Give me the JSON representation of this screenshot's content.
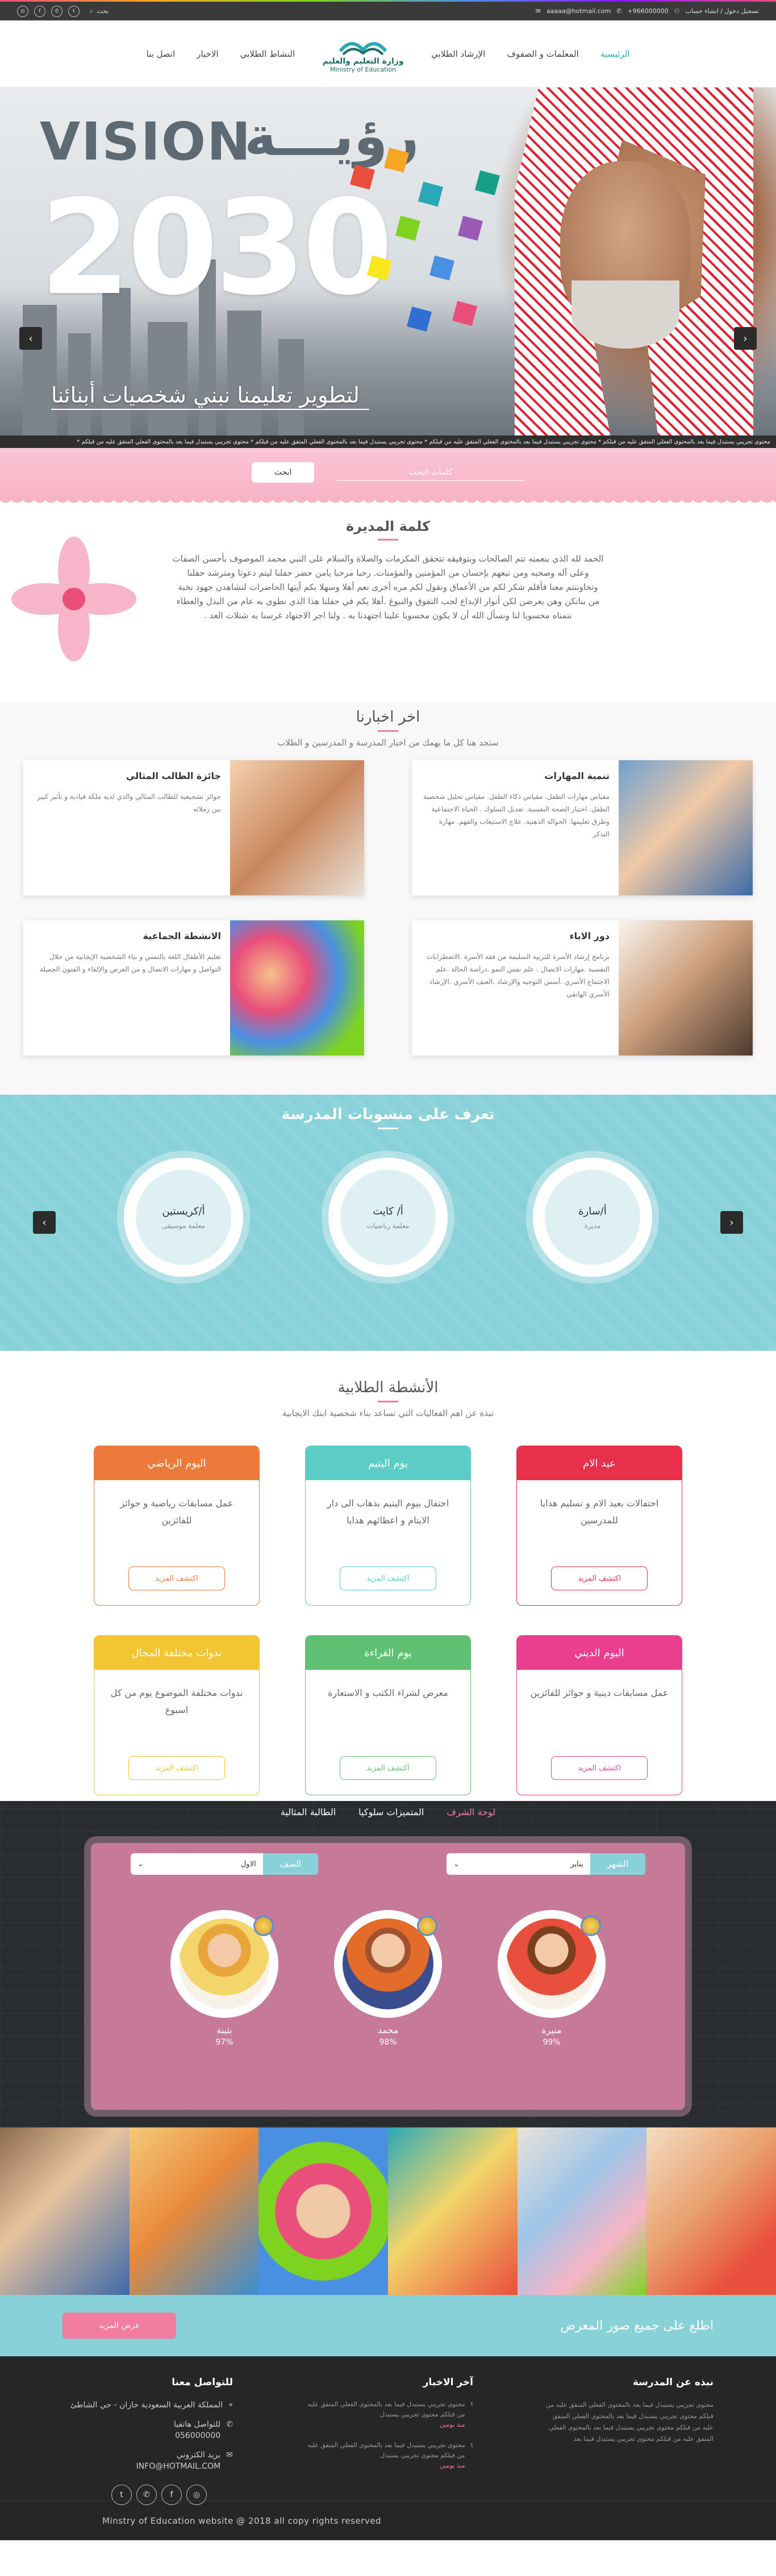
{
  "topbar": {
    "search_label": "بحث",
    "phone": "+966000000",
    "email": "aaaaa@hotmail.com",
    "login": "تسجيل دخول / انشاء حساب",
    "socials": [
      "instagram-icon",
      "facebook-icon",
      "whatsapp-icon",
      "twitter-icon"
    ]
  },
  "nav": {
    "items": [
      "الرئيسية",
      "المعلمات و الصفوف",
      "الإرشاد الطلابي",
      "النشاط الطلابي",
      "الاخبار",
      "اتصل بنا"
    ],
    "active": 0
  },
  "logo": {
    "ar": "وزارة التعليم والعليم",
    "en": "Ministry of Education"
  },
  "hero": {
    "vision": "VISION",
    "ru": "رؤيـــة",
    "year": "2030",
    "tagline": "لتطوير تعليمنا نبني شخصيات أبنائنا"
  },
  "ticker": "محتوى تجريبي يستبدل فيما بعد بالمحتوى الفعلي المتفق عليه من قبلكم * محتوى تجريبي يستبدل فيما بعد بالمحتوى الفعلي المتفق عليه من قبلكم * محتوى تجريبي يستبدل فيما بعد بالمحتوى الفعلي المتفق عليه من قبلكم * محتوى تجريبي يستبدل فيما بعد بالمحتوى الفعلي المتفق عليه من قبلكم *",
  "search": {
    "placeholder": "كلمات البحث",
    "button": "ابحث"
  },
  "principal": {
    "title": "كلمة المديرة",
    "text": "الحمد لله الذي بنعمته تتم الصالحات وبتوفيقه تتحقق المكرمات والصلاة والسلام على النبي محمد الموصوف بأحسن الصفات وعلى آله وصحبه ومن تبعهم بإحسان من المؤمنين والمؤمنات. رحبا مرحبا يامن حضر حفلنا ليتم دعوتا ومترشد حفلنا وتحاوننتم معنا فأقلم شكر لكم من الأعماق ونقول لكم مره أخرى نعم أهلا وسهلا بكم أيتها الحاضرات لتشاهدن جهود نخبة من بناتكن وهن يعرضن لكن أنوار الإبداع لحب التفوق والنبوغ .أهلا بكم في حفلنا هذا الذي نطوي به عام من البذل والعطاء نتمناه محسوبا لنا ونسأل الله أن لا يكون محسوبا علينا اجتهدنا به . ولنا اجر الاجتهاد غرسنا به شتلات العد ."
  },
  "news": {
    "title": "اخر اخبارنا",
    "subtitle": "ستجد هنا كل ما يهمك من اخبار المدرسة و المدرسين و الطلاب",
    "items": [
      {
        "title": "تنمية المهارات",
        "text": "مقياس مهارات الطفل. مقياس ذكاء الطفل. مقياس تحليل شخصية الطفل. اختبار الصحة النفسية. تعديل السلوك . الحياة الاجتماعية وطرق تعليمها. الخوالة الذهنية. علاج الاستيعاب والفهم. مهارة التذكر"
      },
      {
        "title": "جائزة الطالب المثالي",
        "text": "جوائز تشجيعية للطالب المثالي والذي لديه ملكة قيادية و تأثير كبير بين زملائه"
      },
      {
        "title": "دور الاباء",
        "text": "برنامج إرشاد الأسرة للتربية السليمة من فقه الأسرة .الاضطرابات النفسية .مهارات الاتصال . علم نفس النمو .دراسة الحالة .علم الاجتماع الأسري .أسس التوجيه والإرشاد .العنف الأسري .الإرشاد الأسري الهاتفي"
      },
      {
        "title": "الانشطة الجماعية",
        "text": "تعليم الأطفال اللغة بالتمس و بناء الشخصية الإيجابية من خلال التواصل و مهارات الاتصال و من العرض والإلقاء و الفنون الجميلة"
      }
    ]
  },
  "staff": {
    "title": "تعرف على منسوبات المدرسة",
    "members": [
      {
        "name": "أ/سارة",
        "role": "مديرة"
      },
      {
        "name": "أ/ كايت",
        "role": "معلمة رياضيات"
      },
      {
        "name": "أ/كريستين",
        "role": "معلمة موسيقى"
      }
    ]
  },
  "activities": {
    "title": "الأنشطة الطلابية",
    "subtitle": "نبذة عن اهم الفعاليات التي تساعد بناء شخصية ابنك الايجابية",
    "more": "اكتشف المزيد",
    "items": [
      {
        "title": "عيد الام",
        "text": "احتفالات بعيد الام و تسليم هدايا للمدرسين",
        "color": "#e8304b"
      },
      {
        "title": "يوم اليتيم",
        "text": "احتفال بيوم اليتيم بذهاب الى دار الايتام و اعطائهم هدايا",
        "color": "#5ccdc6"
      },
      {
        "title": "اليوم الرياضي",
        "text": "عمل مسابقات رياضية و جوائز للفائزين",
        "color": "#ec7a3a"
      },
      {
        "title": "اليوم الديني",
        "text": "عمل مسابقات دينية و جوائز للفائزين",
        "color": "#ea3f8f"
      },
      {
        "title": "يوم القراءة",
        "text": "معرض لشراء الكتب و الاستعارة",
        "color": "#5fbf72"
      },
      {
        "title": "ندوات مختلفة المجال",
        "text": "ندوات مختلفة الموضوع يوم من كل اسبوع",
        "color": "#f3c532"
      }
    ]
  },
  "honor": {
    "tabs": [
      "لوحة الشرف",
      "المتميزات سلوكيا",
      "الطالبة المثالية"
    ],
    "month_label": "الشهر",
    "month_value": "يناير",
    "class_label": "الصف",
    "class_value": "الاول",
    "students": [
      {
        "name": "منيرة",
        "score": "99%"
      },
      {
        "name": "محمد",
        "score": "98%"
      },
      {
        "name": "بثينة",
        "score": "97%"
      }
    ]
  },
  "gallery": {
    "title": "اطلع على جميع صور المعرض",
    "button": "عرض المزيد"
  },
  "footer": {
    "about_title": "نبذه عن المدرسة",
    "about_text": "محتوى تجريبي يستبدل فيما بعد بالمحتوى الفعلي المتفق عليه من قبلكم محتوى تجريبي يستبدل فيما بعد بالمحتوى الفعلي المتفق عليه من قبلكم محتوى تجريبي يستبدل فيما بعد بالمحتوى الفعلي المتفق عليه من قبلكم محتوى تجريبي يستبدل فيما بعد",
    "news_title": "آخر الاخبار",
    "news_items": [
      {
        "text": "محتوى تجريبي يستبدل فيما بعد بالمحتوى الفعلي المتفق عليه من قبلكم محتوى تجريبي يستبدل",
        "date": "منذ يومين"
      },
      {
        "text": "محتوى تجريبي يستبدل فيما بعد بالمحتوى الفعلي المتفق عليه من قبلكم محتوى تجريبي يستبدل",
        "date": "منذ يومين"
      }
    ],
    "contact_title": "للتواصل معنا",
    "address": "المملكة العربية السعودية جازان - حي الشاطئ",
    "phone_label": "للتواصل هاتفيا",
    "phone": "056000000",
    "email_label": "بريد الكتروني",
    "email": "INFO@HOTMAIL.COM",
    "copyright": "Minstry of Education website @ 2018  all copy rights reserved"
  }
}
